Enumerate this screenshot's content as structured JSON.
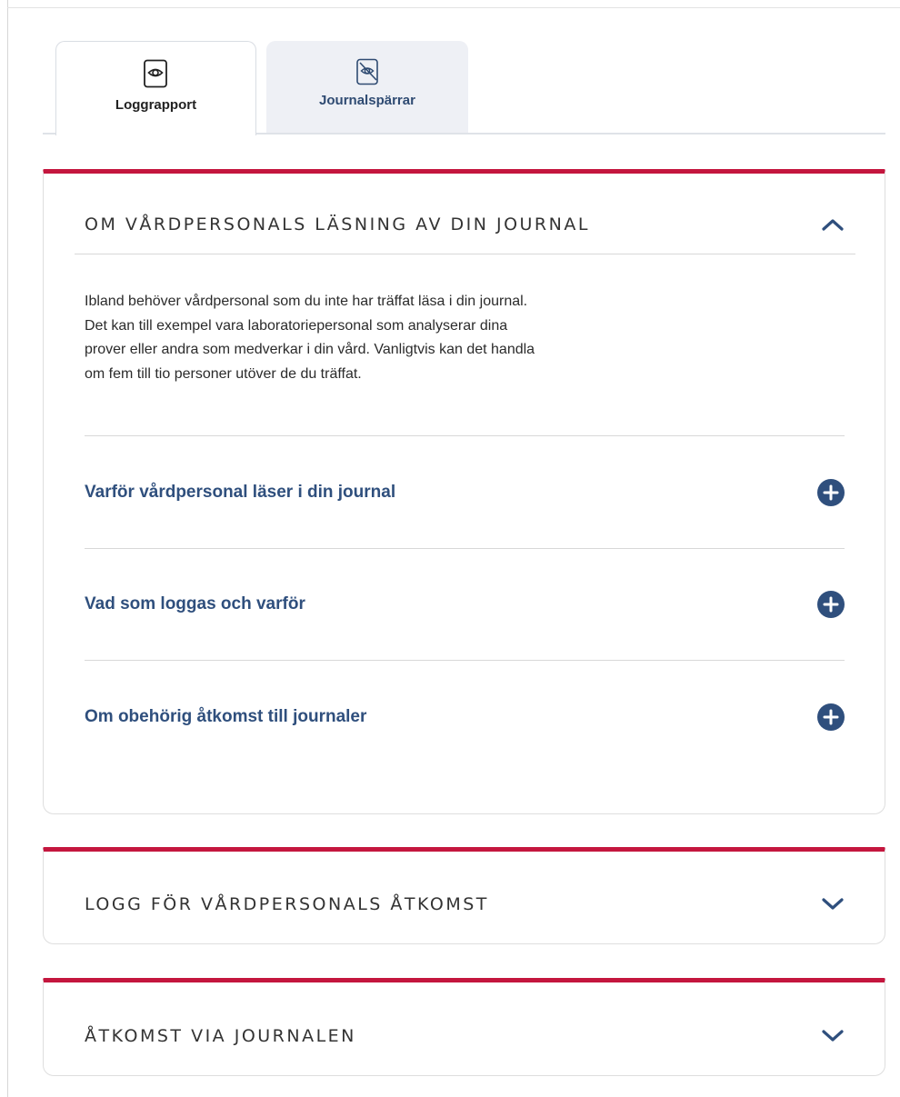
{
  "tabs": [
    {
      "label": "Loggrapport",
      "icon": "eye-icon",
      "active": true
    },
    {
      "label": "Journalspärrar",
      "icon": "eye-off-icon",
      "active": false
    }
  ],
  "colors": {
    "accent": "#c4163e",
    "link": "#2f4f7d",
    "tab_inactive_bg": "#eef0f5"
  },
  "sections": [
    {
      "title": "OM VÅRDPERSONALS LÄSNING AV DIN JOURNAL",
      "expanded": true,
      "paragraph_lines": [
        "Ibland behöver vårdpersonal som du inte har träffat läsa i din journal.",
        "Det kan till exempel vara laboratoriepersonal som analyserar dina",
        "prover eller andra som medverkar i din vård. Vanligtvis kan det handla",
        "om fem till tio personer utöver de du träffat."
      ],
      "subsections": [
        {
          "label": "Varför vårdpersonal läser i din journal"
        },
        {
          "label": "Vad som loggas och varför"
        },
        {
          "label": "Om obehörig åtkomst till journaler"
        }
      ]
    },
    {
      "title": "LOGG FÖR VÅRDPERSONALS ÅTKOMST",
      "expanded": false
    },
    {
      "title": "ÅTKOMST VIA JOURNALEN",
      "expanded": false
    }
  ]
}
